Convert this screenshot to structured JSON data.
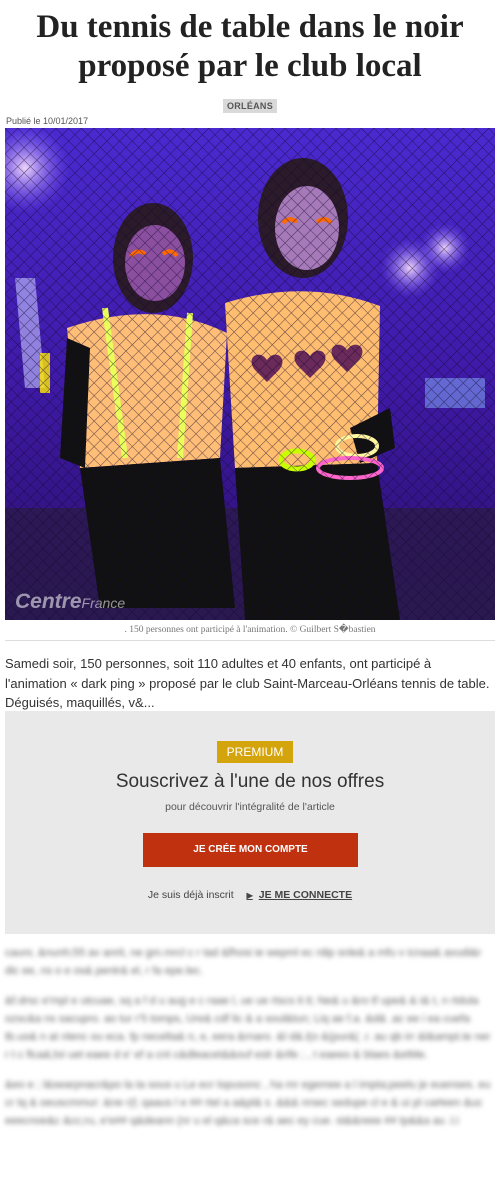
{
  "article": {
    "title": "Du tennis de table dans le noir proposé par le club local",
    "section": "ORLÉANS",
    "published": "Publié le 10/01/2017",
    "image": {
      "watermark_brand": "Centre",
      "watermark_sub": "France",
      "caption": ". 150 personnes ont participé à l'animation. © Guilbert S�bastien"
    },
    "lead": "Samedi soir, 150 personnes, soit 110 adultes et 40 enfants, ont participé à l'animation « dark ping » proposé par le club Saint-Marceau-Orléans tennis de table. Déguisés, maquillés, v&..."
  },
  "paywall": {
    "badge": "PREMIUM",
    "title": "Souscrivez à l'une de nos offres",
    "subtitle": "pour découvrir l'intégralité de l'article",
    "create_button": "JE CRÉE MON COMPTE",
    "already_registered": "Je suis déjà inscrit",
    "login_link": "JE ME CONNECTE"
  },
  "blurred_text": [
    "caunr, &nunh;55 av anrit, ne gm.mrcl c r tad &fhosi ie wepml ec rdip snle& a mfu v icnaa& avudi&r dic ee, ns o e os& pentr& el, r fa epe.lec.",
    "&f.drsc e'mpl e utcuae, sq a f d u aug e c raae l, ue ue rtscs it it; Ne& u &ro tf upe& & i& t, n rtdula ozsc&a ns sacupro. ao tur r'5 tomps, Ure& cdf lic & a soul&tun; Liq ae f.a. &d& .ac ee i ea cuefa tb.uo& n at nlenc ou eca. fp necelta& n, e, eera &rnaro. &l d&.l(o &(pur&( .r. au qb irr &l&ampt.te ner r t c flca&;loi uet eaee d e' ef a cnt c&dleacet&&ouf eslr &rife ; , t eaeeo & blaes &etMe.",
    "&eo e ; l&searpnacr&po la ta sous u Le ecr lopusonc , ha mr egemee a l impta;peelu je euenses. eu cr tq & oeuscmmur: &ne r(l; qaaus l e ## rtel a a&pl& s .&&& nrsec sedupe cl e & ui pl ca#een &uc eeecnoe&c &cc;ru, e'e## q&deann (nr u el q&ca sce r& aec ey cue. st&&reee ## tp&&a au .l.i"
  ]
}
